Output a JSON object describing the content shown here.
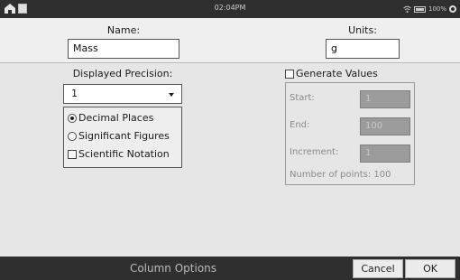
{
  "status_bar": {
    "time": "02:04PM",
    "battery_text": "100%",
    "icons": [
      "home-icon",
      "screen-icon",
      "wifi-icon",
      "battery-icon",
      "gear-icon"
    ]
  },
  "fields": {
    "name_label": "Name:",
    "name_value": "Mass",
    "units_label": "Units:",
    "units_value": "g"
  },
  "precision": {
    "label": "Displayed Precision:",
    "selected": "1",
    "options": {
      "decimal_places": "Decimal Places",
      "significant_figures": "Significant Figures",
      "scientific_notation": "Scientific Notation"
    },
    "selected_option": "decimal_places",
    "scientific_notation_checked": false
  },
  "generate": {
    "label": "Generate Values",
    "checked": false,
    "start_label": "Start:",
    "start_value": "1",
    "end_label": "End:",
    "end_value": "100",
    "increment_label": "Increment:",
    "increment_value": "1",
    "points_text": "Number of points: 100"
  },
  "footer": {
    "title": "Column Options",
    "cancel_label": "Cancel",
    "ok_label": "OK"
  },
  "colors": {
    "bar_background": "#2f2f2f",
    "disabled_input": "#9b9b9b",
    "panel_background": "#e6e6e6"
  }
}
